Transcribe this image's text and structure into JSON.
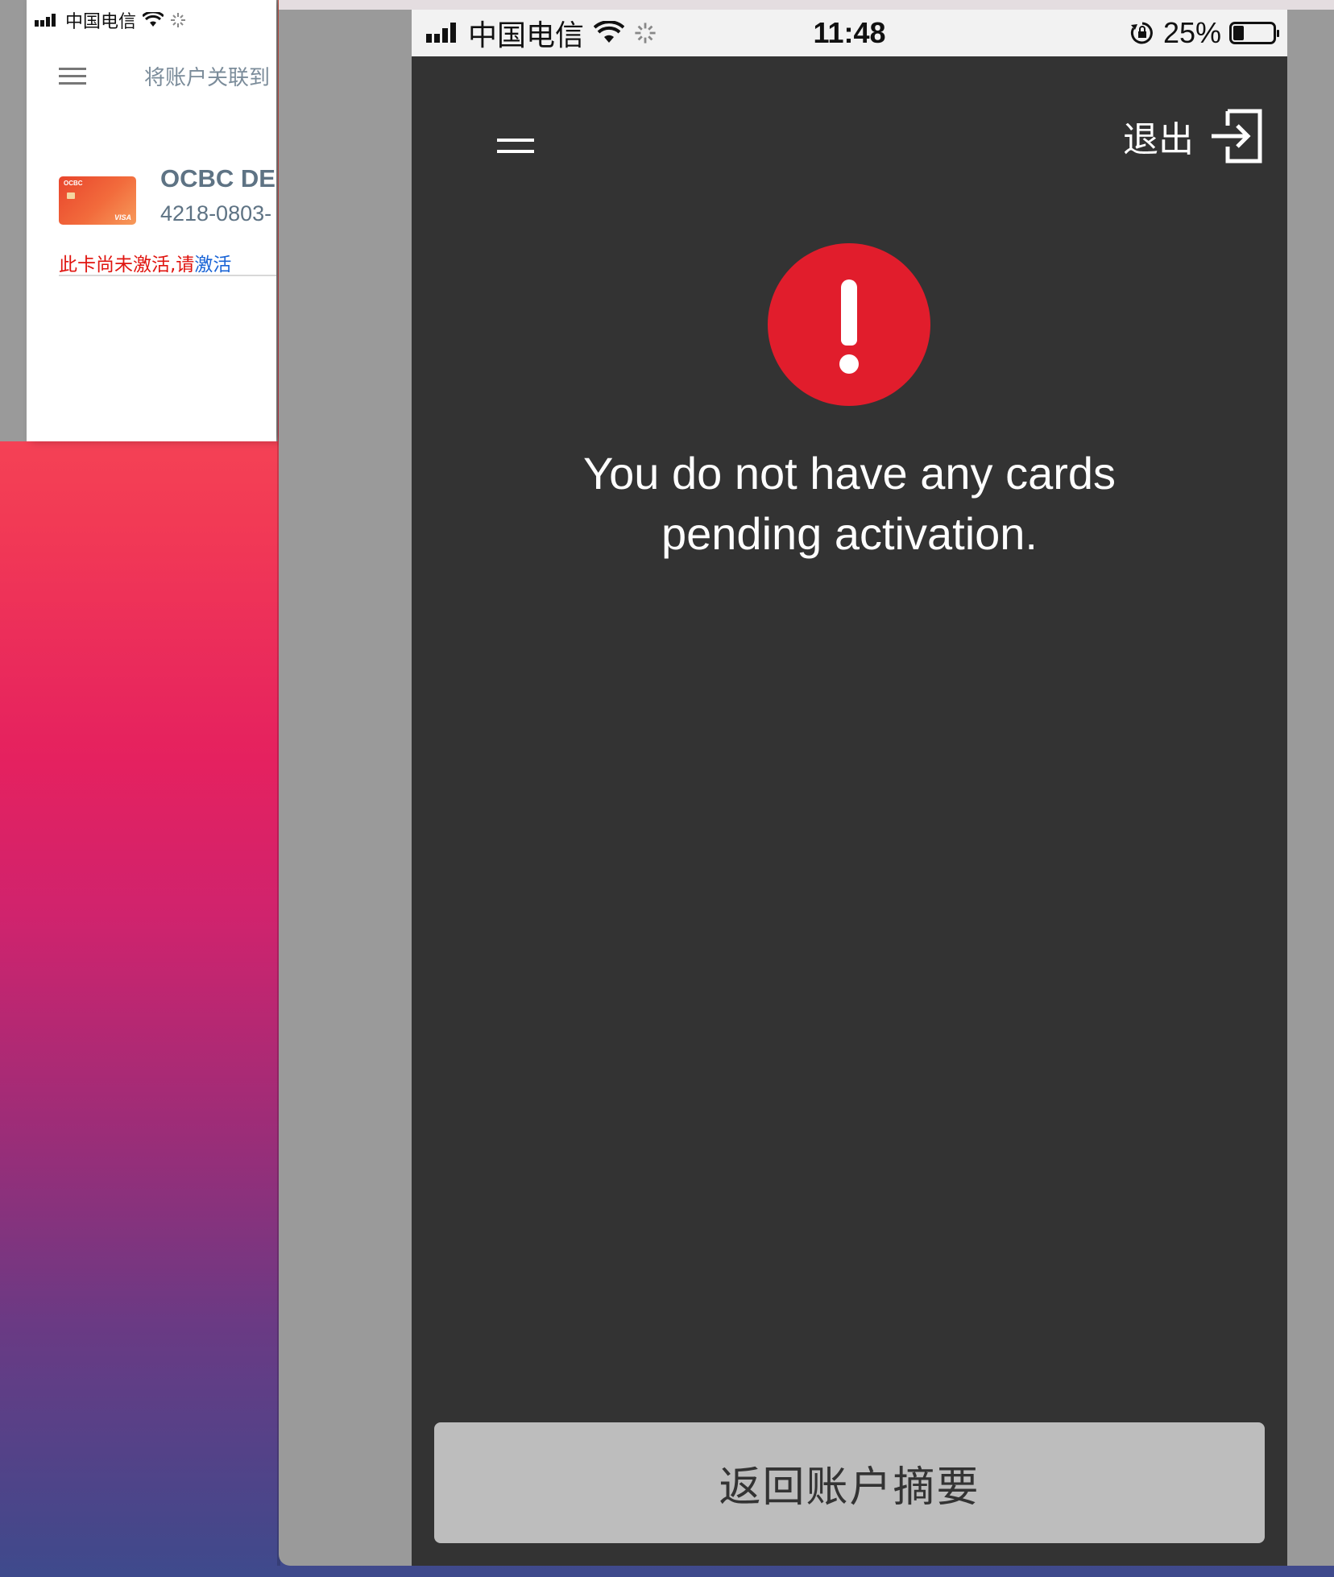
{
  "left_phone": {
    "status": {
      "carrier": "中国电信"
    },
    "title": "将账户关联到",
    "card": {
      "logo": "OCBC",
      "network": "VISA",
      "name": "OCBC DEI",
      "number": "4218-0803-"
    },
    "warning": {
      "text": "此卡尚未激活,请",
      "link": "激活"
    }
  },
  "phone": {
    "status": {
      "carrier": "中国电信",
      "time": "11:48",
      "battery": "25%"
    },
    "header": {
      "logout_label": "退出"
    },
    "message": {
      "line1": "You do not have any cards",
      "line2": "pending activation."
    },
    "back_button_label": "返回账户摘要"
  },
  "colors": {
    "alert_red": "#e11d2c",
    "screen_bg": "#333333",
    "button_bg": "#bdbdbd",
    "warning_red": "#e0140f",
    "link_blue": "#1a64d6"
  },
  "icons": [
    "signal-icon",
    "wifi-icon",
    "loading-spinner-icon",
    "rotation-lock-icon",
    "battery-icon",
    "menu-icon",
    "logout-icon",
    "alert-icon"
  ]
}
